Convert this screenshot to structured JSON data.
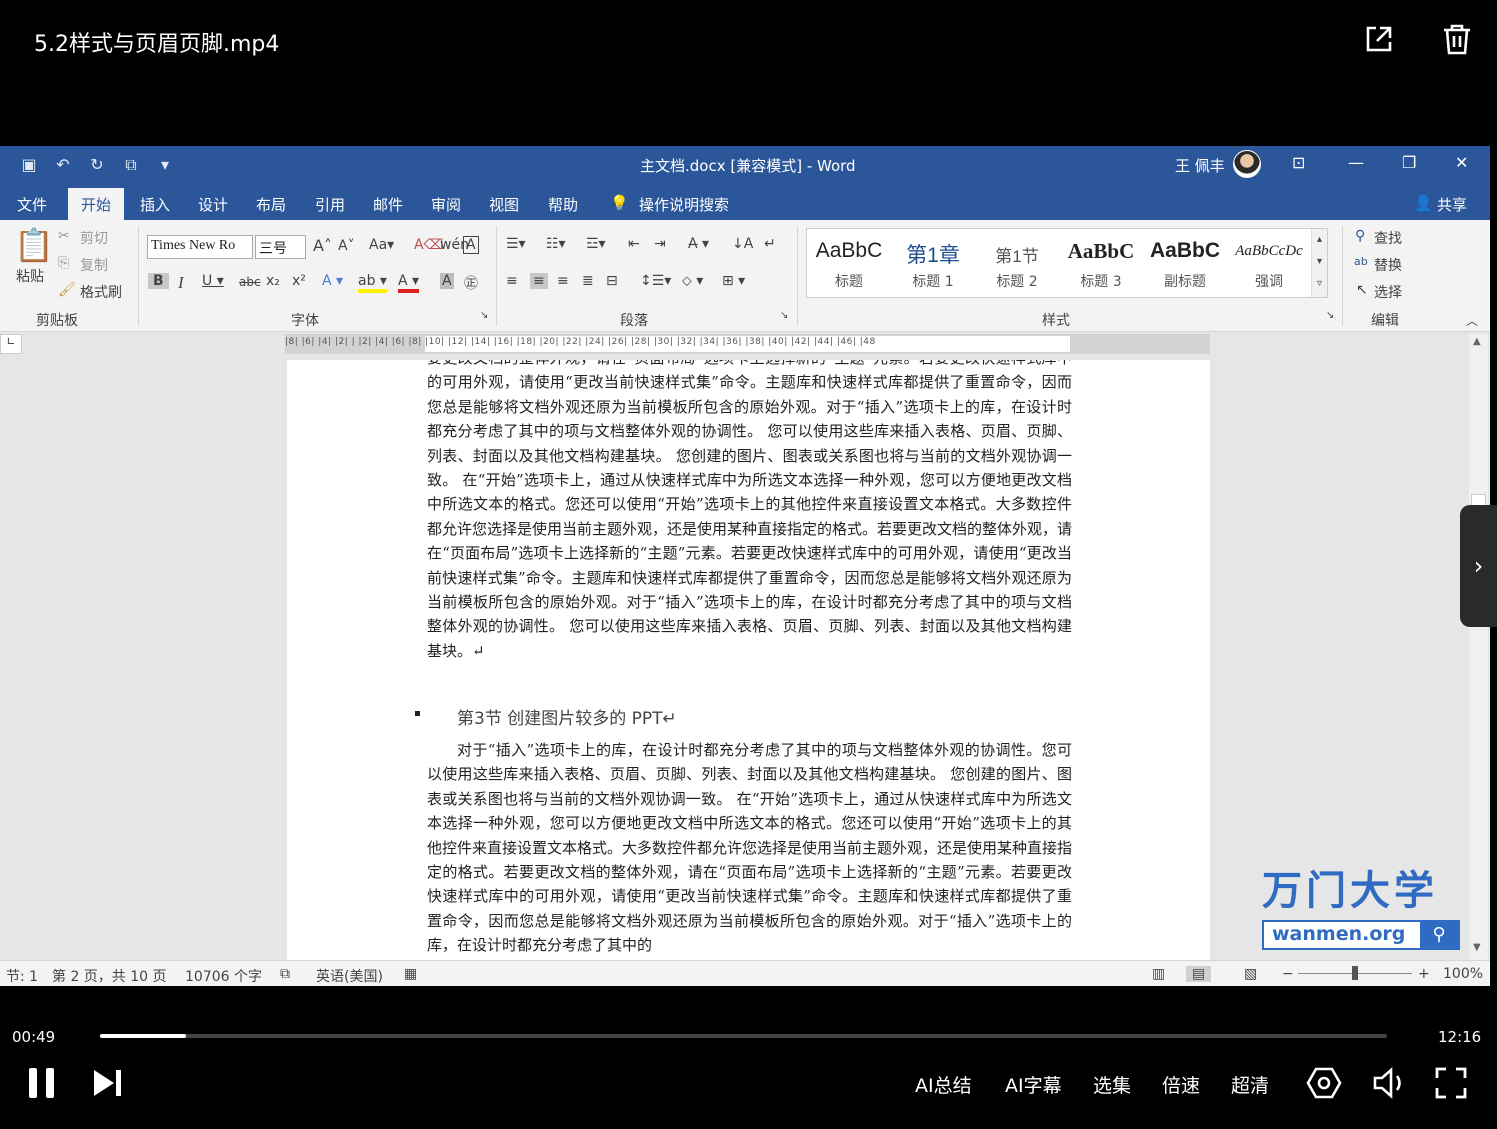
{
  "player": {
    "title": "5.2样式与页眉页脚.mp4",
    "time_current": "00:49",
    "time_total": "12:16",
    "progress": 0.067,
    "controls": [
      "AI总结",
      "AI字幕",
      "选集",
      "倍速",
      "超清"
    ]
  },
  "word": {
    "title": "主文档.docx [兼容模式]  -  Word",
    "user": "王 佩丰",
    "tabs": [
      "文件",
      "开始",
      "插入",
      "设计",
      "布局",
      "引用",
      "邮件",
      "审阅",
      "视图",
      "帮助"
    ],
    "active_tab": "开始",
    "search_label": "操作说明搜索",
    "share_label": "共享",
    "clipboard": {
      "paste": "粘贴",
      "cut": "剪切",
      "copy": "复制",
      "format_painter": "格式刷",
      "label": "剪贴板"
    },
    "font": {
      "name": "Times New Ro",
      "size": "三号",
      "label": "字体"
    },
    "paragraph_label": "段落",
    "styles": {
      "label": "样式",
      "items": [
        {
          "sample": "AaBbC",
          "name": "标题"
        },
        {
          "sample": "第1章",
          "name": "标题 1"
        },
        {
          "sample": "第1节",
          "name": "标题 2"
        },
        {
          "sample": "AaBbC",
          "name": "标题 3"
        },
        {
          "sample": "AaBbC",
          "name": "副标题"
        },
        {
          "sample": "AaBbCcDc",
          "name": "强调"
        }
      ]
    },
    "editing": {
      "find": "查找",
      "replace": "替换",
      "select": "选择",
      "label": "编辑"
    },
    "ruler_text": "|8|  |6|  |4|  |2|  |   |2|  |4|  |6|  |8|  |10|  |12|  |14|  |16|  |18|  |20|  |22|  |24|  |26|  |28|  |30|  |32|  |34|  |36|  |38|  |40|  |42|  |44|  |46|  |48",
    "doc": {
      "para1": "要更改文档的整体外观，请在“页面布局”选项卡上选择新的“主题”元素。若要更改快速样式库中的可用外观，请使用“更改当前快速样式集”命令。主题库和快速样式库都提供了重置命令，因而您总是能够将文档外观还原为当前模板所包含的原始外观。对于“插入”选项卡上的库，在设计时都充分考虑了其中的项与文档整体外观的协调性。 您可以使用这些库来插入表格、页眉、页脚、列表、封面以及其他文档构建基块。 您创建的图片、图表或关系图也将与当前的文档外观协调一致。 在“开始”选项卡上，通过从快速样式库中为所选文本选择一种外观，您可以方便地更改文档中所选文本的格式。您还可以使用“开始”选项卡上的其他控件来直接设置文本格式。大多数控件都允许您选择是使用当前主题外观，还是使用某种直接指定的格式。若要更改文档的整体外观，请在“页面布局”选项卡上选择新的“主题”元素。若要更改快速样式库中的可用外观，请使用“更改当前快速样式集”命令。主题库和快速样式库都提供了重置命令，因而您总是能够将文档外观还原为当前模板所包含的原始外观。对于“插入”选项卡上的库，在设计时都充分考虑了其中的项与文档整体外观的协调性。 您可以使用这些库来插入表格、页眉、页脚、列表、封面以及其他文档构建基块。↵",
      "heading": "第3节 创建图片较多的 PPT↵",
      "para2": "对于“插入”选项卡上的库，在设计时都充分考虑了其中的项与文档整体外观的协调性。您可以使用这些库来插入表格、页眉、页脚、列表、封面以及其他文档构建基块。 您创建的图片、图表或关系图也将与当前的文档外观协调一致。 在“开始”选项卡上，通过从快速样式库中为所选文本选择一种外观，您可以方便地更改文档中所选文本的格式。您还可以使用“开始”选项卡上的其他控件来直接设置文本格式。大多数控件都允许您选择是使用当前主题外观，还是使用某种直接指定的格式。若要更改文档的整体外观，请在“页面布局”选项卡上选择新的“主题”元素。若要更改快速样式库中的可用外观，请使用“更改当前快速样式集”命令。主题库和快速样式库都提供了重置命令，因而您总是能够将文档外观还原为当前模板所包含的原始外观。对于“插入”选项卡上的库，在设计时都充分考虑了其中的"
    },
    "status": {
      "section": "节: 1",
      "page": "第 2 页，共 10 页",
      "words": "10706 个字",
      "language": "英语(美国)",
      "zoom": "100%"
    }
  },
  "watermark": {
    "brand": "万门大学",
    "url": "wanmen.org"
  },
  "colors": {
    "word_blue": "#2b579a",
    "watermark_blue": "#2f6bc2"
  }
}
